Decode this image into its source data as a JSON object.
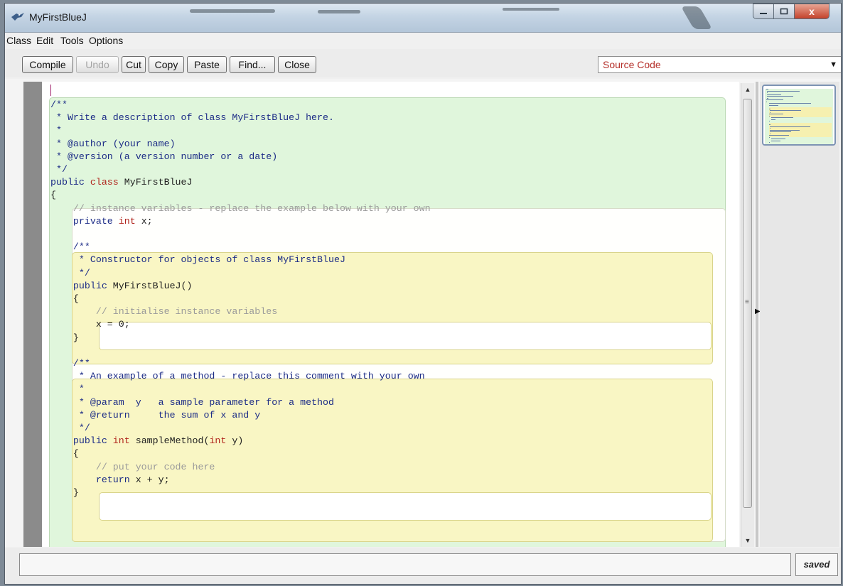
{
  "window": {
    "title": "MyFirstBlueJ",
    "controls": {
      "minimize": "–",
      "maximize": "□",
      "close": "x"
    }
  },
  "menu": [
    "Class",
    "Edit",
    "Tools",
    "Options"
  ],
  "toolbar": {
    "compile": "Compile",
    "undo": "Undo",
    "undo_enabled": false,
    "cut": "Cut",
    "copy": "Copy",
    "paste": "Paste",
    "find": "Find...",
    "close": "Close",
    "view_selected": "Source Code"
  },
  "editor": {
    "lines": [
      {
        "kind": "doc",
        "segs": [
          [
            "doc",
            "/**"
          ]
        ]
      },
      {
        "kind": "doc",
        "segs": [
          [
            "doc",
            " * Write a description of class MyFirstBlueJ here."
          ]
        ]
      },
      {
        "kind": "doc",
        "segs": [
          [
            "doc",
            " *"
          ]
        ]
      },
      {
        "kind": "doc",
        "segs": [
          [
            "doc",
            " * @author (your name)"
          ]
        ]
      },
      {
        "kind": "doc",
        "segs": [
          [
            "doc",
            " * @version (a version number or a date)"
          ]
        ]
      },
      {
        "kind": "doc",
        "segs": [
          [
            "doc",
            " */"
          ]
        ]
      },
      {
        "kind": "code",
        "segs": [
          [
            "doc",
            "public "
          ],
          [
            "kw",
            "class"
          ],
          [
            "plain",
            " MyFirstBlueJ"
          ]
        ]
      },
      {
        "kind": "code",
        "segs": [
          [
            "plain",
            "{"
          ]
        ]
      },
      {
        "kind": "com",
        "segs": [
          [
            "com",
            "    // instance variables - replace the example below with your own"
          ]
        ]
      },
      {
        "kind": "code",
        "segs": [
          [
            "doc",
            "    private "
          ],
          [
            "kw",
            "int"
          ],
          [
            "plain",
            " x;"
          ]
        ]
      },
      {
        "kind": "blank",
        "segs": [
          [
            "plain",
            ""
          ]
        ]
      },
      {
        "kind": "doc",
        "segs": [
          [
            "doc",
            "    /**"
          ]
        ]
      },
      {
        "kind": "doc",
        "segs": [
          [
            "doc",
            "     * Constructor for objects of class MyFirstBlueJ"
          ]
        ]
      },
      {
        "kind": "doc",
        "segs": [
          [
            "doc",
            "     */"
          ]
        ]
      },
      {
        "kind": "code",
        "segs": [
          [
            "doc",
            "    public"
          ],
          [
            "plain",
            " MyFirstBlueJ()"
          ]
        ]
      },
      {
        "kind": "code",
        "segs": [
          [
            "plain",
            "    {"
          ]
        ]
      },
      {
        "kind": "com",
        "segs": [
          [
            "com",
            "        // initialise instance variables"
          ]
        ]
      },
      {
        "kind": "code",
        "segs": [
          [
            "plain",
            "        x = 0;"
          ]
        ]
      },
      {
        "kind": "code",
        "segs": [
          [
            "plain",
            "    }"
          ]
        ]
      },
      {
        "kind": "blank",
        "segs": [
          [
            "plain",
            ""
          ]
        ]
      },
      {
        "kind": "doc",
        "segs": [
          [
            "doc",
            "    /**"
          ]
        ]
      },
      {
        "kind": "doc",
        "segs": [
          [
            "doc",
            "     * An example of a method - replace this comment with your own"
          ]
        ]
      },
      {
        "kind": "doc",
        "segs": [
          [
            "doc",
            "     *"
          ]
        ]
      },
      {
        "kind": "doc",
        "segs": [
          [
            "doc",
            "     * @param  y   a sample parameter for a method"
          ]
        ]
      },
      {
        "kind": "doc",
        "segs": [
          [
            "doc",
            "     * @return     the sum of x and y"
          ]
        ]
      },
      {
        "kind": "doc",
        "segs": [
          [
            "doc",
            "     */"
          ]
        ]
      },
      {
        "kind": "code",
        "segs": [
          [
            "doc",
            "    public "
          ],
          [
            "kw",
            "int"
          ],
          [
            "plain",
            " sampleMethod("
          ],
          [
            "kw",
            "int"
          ],
          [
            "plain",
            " y)"
          ]
        ]
      },
      {
        "kind": "code",
        "segs": [
          [
            "plain",
            "    {"
          ]
        ]
      },
      {
        "kind": "com",
        "segs": [
          [
            "com",
            "        // put your code here"
          ]
        ]
      },
      {
        "kind": "code",
        "segs": [
          [
            "doc",
            "        return"
          ],
          [
            "plain",
            " x + y;"
          ]
        ]
      },
      {
        "kind": "code",
        "segs": [
          [
            "plain",
            "    }"
          ]
        ]
      }
    ]
  },
  "status": {
    "message": "",
    "saved": "saved"
  },
  "colors": {
    "class_scope": "#e0f6dc",
    "method_scope": "#f9f6c4",
    "keyword": "#b0241c",
    "doc_comment": "#1b2b86",
    "line_comment": "#9a9a9a"
  },
  "icons": {
    "app": "bluej-bird-icon",
    "view_arrow": "chevron-down-icon"
  }
}
